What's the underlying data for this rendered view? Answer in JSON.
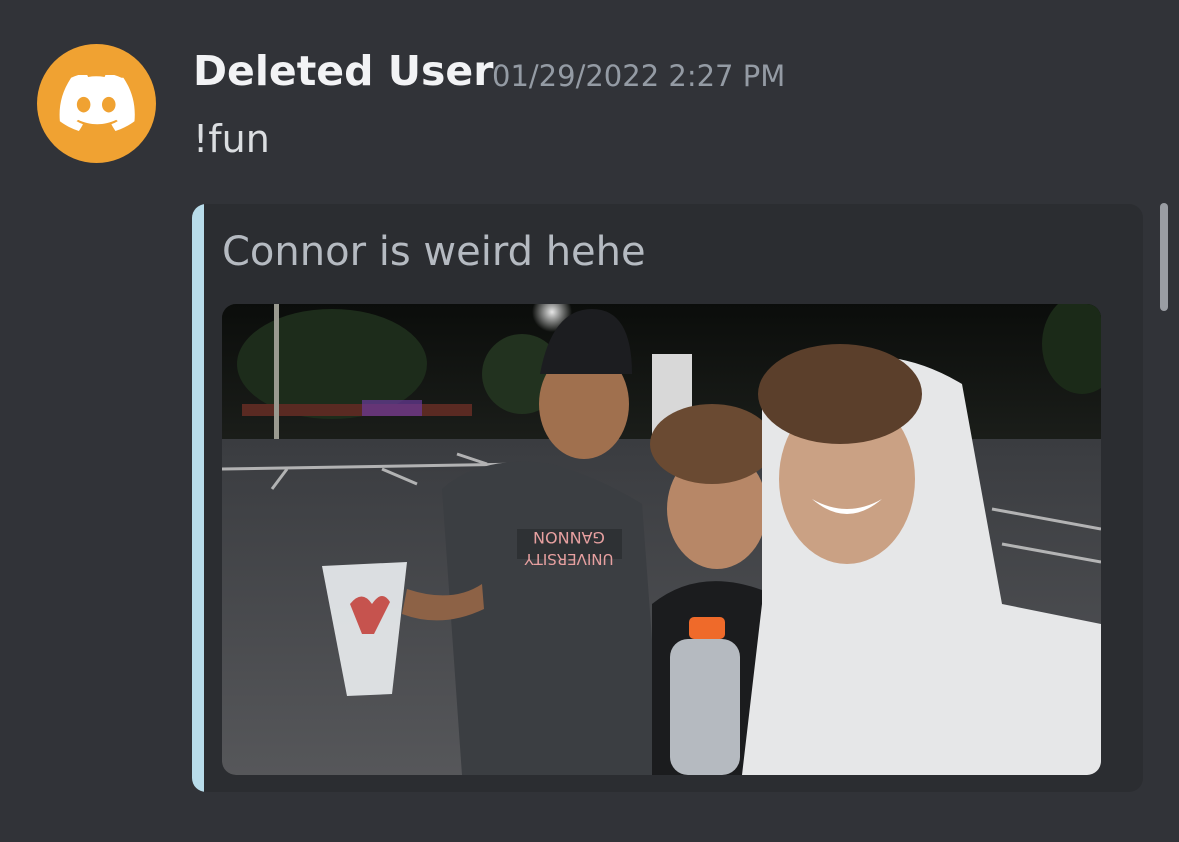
{
  "message": {
    "author": "Deleted User",
    "timestamp": "01/29/2022 2:27 PM",
    "content": "!fun",
    "avatar_icon": "discord-logo-icon",
    "avatar_color": "#f0a232"
  },
  "embed": {
    "title": "Connor is weird hehe",
    "accent_color": "#b8dcea",
    "image": {
      "shirt_text_line1": "GANNON",
      "shirt_text_line2": "UNIVERSITY"
    }
  }
}
